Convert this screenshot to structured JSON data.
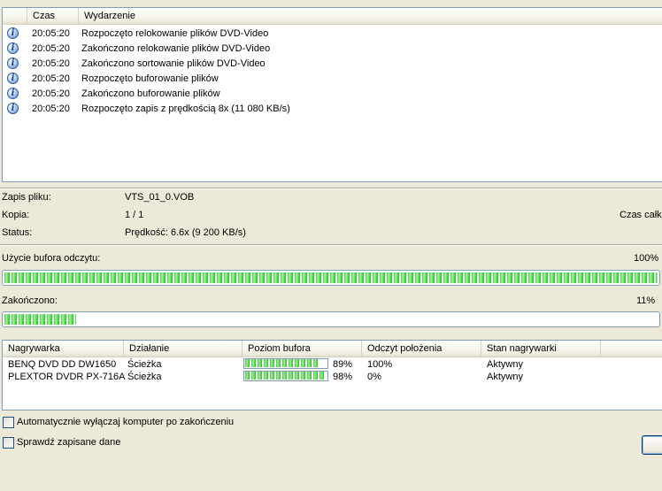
{
  "log": {
    "columns": {
      "time": "Czas",
      "event": "Wydarzenie"
    },
    "rows": [
      {
        "icon": "info-icon",
        "time": "20:05:20",
        "message": "Rozpoczęto relokowanie plików DVD-Video"
      },
      {
        "icon": "info-icon",
        "time": "20:05:20",
        "message": "Zakończono relokowanie plików DVD-Video"
      },
      {
        "icon": "info-icon",
        "time": "20:05:20",
        "message": "Zakończono sortowanie plików DVD-Video"
      },
      {
        "icon": "info-icon",
        "time": "20:05:20",
        "message": "Rozpoczęto buforowanie plików"
      },
      {
        "icon": "info-icon",
        "time": "20:05:20",
        "message": "Zakończono buforowanie plików"
      },
      {
        "icon": "info-icon",
        "time": "20:05:20",
        "message": "Rozpoczęto zapis z prędkością 8x (11 080 KB/s)"
      }
    ]
  },
  "info": {
    "file_label": "Zapis pliku:",
    "file_value": "VTS_01_0.VOB",
    "copy_label": "Kopia:",
    "copy_value": "1 / 1",
    "total_time_label": "Czas całk",
    "status_label": "Status:",
    "status_value": "Prędkość: 6.6x (9 200 KB/s)"
  },
  "read_buffer": {
    "label": "Użycie bufora odczytu:",
    "percent_text": "100%",
    "fraction": 1.0
  },
  "completed": {
    "label": "Zakończono:",
    "percent_text": "11%",
    "fraction": 0.11
  },
  "drives": {
    "columns": {
      "recorder": "Nagrywarka",
      "action": "Działanie",
      "buffer": "Poziom bufora",
      "position": "Odczyt położenia",
      "state": "Stan nagrywarki"
    },
    "rows": [
      {
        "recorder": "BENQ DVD DD DW1650",
        "action": "Ścieżka",
        "buffer_fraction": 0.89,
        "buffer_text": "89%",
        "position": "100%",
        "state": "Aktywny"
      },
      {
        "recorder": "PLEXTOR DVDR   PX-716A",
        "action": "Ścieżka",
        "buffer_fraction": 0.98,
        "buffer_text": "98%",
        "position": "0%",
        "state": "Aktywny"
      }
    ]
  },
  "options": {
    "auto_shutdown": "Automatycznie wyłączaj komputer po zakończeniu",
    "verify": "Sprawdź zapisane dane"
  }
}
